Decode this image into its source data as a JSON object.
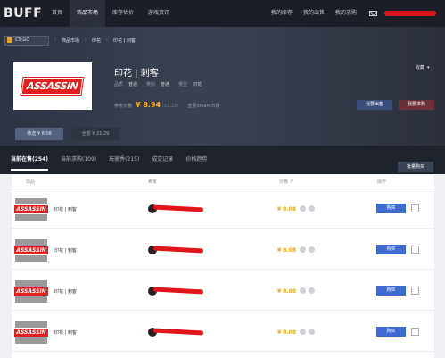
{
  "topnav": {
    "logo": "BUFF",
    "items": [
      "首页",
      "饰品市场",
      "库存估价",
      "游戏资讯"
    ],
    "active_index": 1,
    "right_items": [
      "我的库存",
      "我的出售",
      "我的求购"
    ]
  },
  "breadcrumb": {
    "game": "CS:GO",
    "items": [
      "饰品市场",
      "印花",
      "印花 | 刺客"
    ]
  },
  "item": {
    "sticker_text": "ASSASSIN",
    "title": "印花 | 刺客",
    "tags": [
      {
        "label": "品质",
        "value": "普通"
      },
      {
        "label": "类别",
        "value": "普通"
      },
      {
        "label": "类型",
        "value": "印花"
      }
    ],
    "ref_price_label": "参考价格",
    "price": "¥ 8.94",
    "price_usd": "($1.28)",
    "steam_link": "查看Steam市场",
    "collect_label": "收藏",
    "sell_button": "我要出售",
    "buy_request_button": "我要求购"
  },
  "sub_buttons": [
    "筛选  ¥ 8.08",
    "全部  ¥ 21.29"
  ],
  "tabs": [
    "当前在售(254)",
    "当前求购(109)",
    "玩家秀(215)",
    "成交记录",
    "价格趋势"
  ],
  "bulk_buy": "批量购买",
  "table": {
    "headers": [
      "饰品",
      "卖家",
      "价格 ↑",
      "操作"
    ],
    "rows": [
      {
        "name": "印花 | 刺客",
        "price": "¥ 8.08",
        "buy": "购买",
        "mini": "ASSASSIN"
      },
      {
        "name": "印花 | 刺客",
        "price": "¥ 8.08",
        "buy": "购买",
        "mini": "ASSASSIN"
      },
      {
        "name": "印花 | 刺客",
        "price": "¥ 8.08",
        "buy": "购买",
        "mini": "ASSASSIN"
      },
      {
        "name": "印花 | 刺客",
        "price": "¥ 8.08",
        "buy": "购买",
        "mini": "ASSASSIN"
      }
    ]
  },
  "colors": {
    "accent_blue": "#3f6bd0",
    "price_orange": "#f3a51b",
    "redaction": "#e2151b"
  }
}
